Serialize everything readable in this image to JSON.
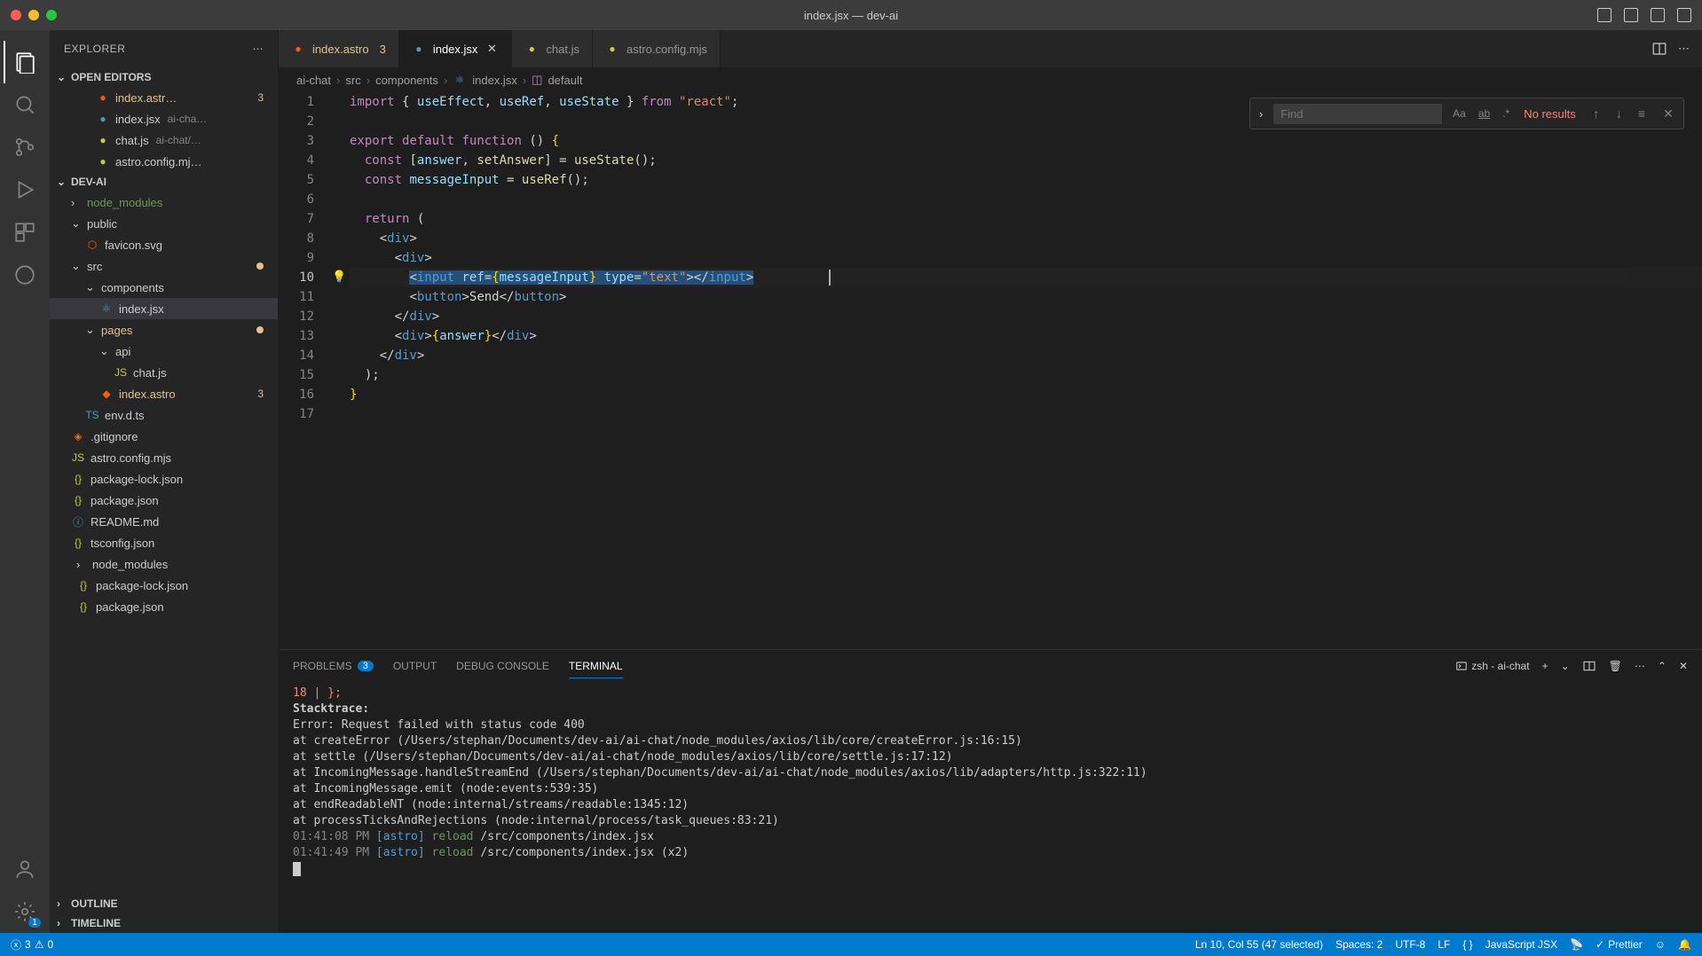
{
  "titlebar": {
    "title": "index.jsx — dev-ai"
  },
  "explorer": {
    "title": "EXPLORER",
    "openEditors": {
      "label": "OPEN EDITORS",
      "items": [
        {
          "name": "index.astr…",
          "iconClass": "fi-astro",
          "badge": "3",
          "closable": false
        },
        {
          "name": "index.jsx",
          "desc": "ai-cha…",
          "iconClass": "fi-jsx",
          "closable": true
        },
        {
          "name": "chat.js",
          "desc": "ai-chat/…",
          "iconClass": "fi-js",
          "closable": false
        },
        {
          "name": "astro.config.mj…",
          "iconClass": "fi-js",
          "closable": false
        }
      ]
    },
    "project": {
      "label": "DEV-AI"
    },
    "tree": [
      {
        "indent": 1,
        "chev": "›",
        "icon": "",
        "label": "node_modules",
        "dim": true
      },
      {
        "indent": 1,
        "chev": "⌄",
        "icon": "",
        "label": "public"
      },
      {
        "indent": 2,
        "icon": "⬡",
        "iconClass": "fi-astro",
        "label": "favicon.svg"
      },
      {
        "indent": 1,
        "chev": "⌄",
        "icon": "",
        "label": "src",
        "modified": true
      },
      {
        "indent": 2,
        "chev": "⌄",
        "icon": "",
        "label": "components"
      },
      {
        "indent": 3,
        "icon": "⚛",
        "iconClass": "fi-jsx",
        "label": "index.jsx",
        "active": true
      },
      {
        "indent": 2,
        "chev": "⌄",
        "icon": "",
        "label": "pages",
        "warn": true,
        "modified": true
      },
      {
        "indent": 3,
        "chev": "⌄",
        "icon": "",
        "label": "api"
      },
      {
        "indent": 4,
        "icon": "JS",
        "iconClass": "fi-js",
        "label": "chat.js"
      },
      {
        "indent": 3,
        "icon": "◆",
        "iconClass": "fi-astro",
        "label": "index.astro",
        "warn": true,
        "badge": "3"
      },
      {
        "indent": 2,
        "icon": "TS",
        "iconClass": "fi-ts",
        "label": "env.d.ts"
      },
      {
        "indent": 1,
        "icon": "◈",
        "iconClass": "fi-git",
        "label": ".gitignore"
      },
      {
        "indent": 1,
        "icon": "JS",
        "iconClass": "fi-js",
        "label": "astro.config.mjs"
      },
      {
        "indent": 1,
        "icon": "{}",
        "iconClass": "fi-json",
        "label": "package-lock.json"
      },
      {
        "indent": 1,
        "icon": "{}",
        "iconClass": "fi-json",
        "label": "package.json"
      },
      {
        "indent": 1,
        "icon": "ⓘ",
        "iconClass": "fi-md",
        "label": "README.md"
      },
      {
        "indent": 1,
        "icon": "{}",
        "iconClass": "fi-json",
        "label": "tsconfig.json"
      },
      {
        "indent": 0,
        "chev": "›",
        "icon": "",
        "label": "node_modules"
      },
      {
        "indent": 0,
        "icon": "{}",
        "iconClass": "fi-json",
        "label": "package-lock.json"
      },
      {
        "indent": 0,
        "icon": "{}",
        "iconClass": "fi-json",
        "label": "package.json"
      }
    ],
    "outline": {
      "label": "OUTLINE"
    },
    "timeline": {
      "label": "TIMELINE"
    }
  },
  "tabs": [
    {
      "label": "index.astro",
      "iconClass": "fi-astro",
      "badge": "3",
      "warn": true
    },
    {
      "label": "index.jsx",
      "iconClass": "fi-jsx",
      "active": true,
      "close": true
    },
    {
      "label": "chat.js",
      "iconClass": "fi-js"
    },
    {
      "label": "astro.config.mjs",
      "iconClass": "fi-js"
    }
  ],
  "breadcrumb": [
    "ai-chat",
    "src",
    "components",
    "index.jsx",
    "default"
  ],
  "find": {
    "placeholder": "Find",
    "results": "No results"
  },
  "code": {
    "lines": [
      {
        "n": 1,
        "html": "<span class='tok-kw'>import</span> <span class='tok-punc'>{</span> <span class='tok-var'>useEffect</span><span class='tok-punc'>,</span> <span class='tok-var'>useRef</span><span class='tok-punc'>,</span> <span class='tok-var'>useState</span> <span class='tok-punc'>}</span> <span class='tok-kw'>from</span> <span class='tok-str'>\"react\"</span><span class='tok-punc'>;</span>"
      },
      {
        "n": 2,
        "html": ""
      },
      {
        "n": 3,
        "html": "<span class='tok-kw'>export</span> <span class='tok-kw'>default</span> <span class='tok-kw'>function</span> <span class='tok-punc'>()</span> <span class='tok-brace'>{</span>"
      },
      {
        "n": 4,
        "html": "  <span class='tok-kw'>const</span> <span class='tok-punc'>[</span><span class='tok-var'>answer</span><span class='tok-punc'>,</span> <span class='tok-fn'>setAnswer</span><span class='tok-punc'>]</span> <span class='tok-punc'>=</span> <span class='tok-fn'>useState</span><span class='tok-punc'>();</span>"
      },
      {
        "n": 5,
        "html": "  <span class='tok-kw'>const</span> <span class='tok-var'>messageInput</span> <span class='tok-punc'>=</span> <span class='tok-fn'>useRef</span><span class='tok-punc'>();</span>"
      },
      {
        "n": 6,
        "html": ""
      },
      {
        "n": 7,
        "html": "  <span class='tok-kw'>return</span> <span class='tok-punc'>(</span>"
      },
      {
        "n": 8,
        "html": "    <span class='tok-punc'>&lt;</span><span class='tok-tag'>div</span><span class='tok-punc'>&gt;</span>"
      },
      {
        "n": 9,
        "html": "      <span class='tok-punc'>&lt;</span><span class='tok-tag'>div</span><span class='tok-punc'>&gt;</span>"
      },
      {
        "n": 10,
        "html": "        <span class='sel'><span class='tok-punc'>&lt;</span><span class='tok-tag'>input</span> <span class='tok-var'>ref</span><span class='tok-punc'>=</span><span class='tok-brace'>{</span><span class='tok-var'>messageInput</span><span class='tok-brace'>}</span> <span class='tok-var'>type</span><span class='tok-punc'>=</span><span class='tok-str'>\"text\"</span><span class='tok-punc'>&gt;&lt;/</span><span class='tok-tag'>input</span><span class='tok-punc'>&gt;</span></span>",
        "active": true
      },
      {
        "n": 11,
        "html": "        <span class='tok-punc'>&lt;</span><span class='tok-tag'>button</span><span class='tok-punc'>&gt;</span><span class='tok-text'>Send</span><span class='tok-punc'>&lt;/</span><span class='tok-tag'>button</span><span class='tok-punc'>&gt;</span>"
      },
      {
        "n": 12,
        "html": "      <span class='tok-punc'>&lt;/</span><span class='tok-tag'>div</span><span class='tok-punc'>&gt;</span>"
      },
      {
        "n": 13,
        "html": "      <span class='tok-punc'>&lt;</span><span class='tok-tag'>div</span><span class='tok-punc'>&gt;</span><span class='tok-brace'>{</span><span class='tok-var'>answer</span><span class='tok-brace'>}</span><span class='tok-punc'>&lt;/</span><span class='tok-tag'>div</span><span class='tok-punc'>&gt;</span>"
      },
      {
        "n": 14,
        "html": "    <span class='tok-punc'>&lt;/</span><span class='tok-tag'>div</span><span class='tok-punc'>&gt;</span>"
      },
      {
        "n": 15,
        "html": "  <span class='tok-punc'>);</span>"
      },
      {
        "n": 16,
        "html": "<span class='tok-brace'>}</span>"
      },
      {
        "n": 17,
        "html": ""
      }
    ]
  },
  "panel": {
    "tabs": {
      "problems": "PROBLEMS",
      "problemsBadge": "3",
      "output": "OUTPUT",
      "debug": "DEBUG CONSOLE",
      "terminal": "TERMINAL"
    },
    "terminalName": "zsh - ai-chat",
    "lines": [
      "<span class='term-red'>  18 | };</span>",
      "<span class='term-bold'>  Stacktrace:</span>",
      "Error: Request failed with status code 400",
      "    at createError (/Users/stephan/Documents/dev-ai/ai-chat/node_modules/axios/lib/core/createError.js:16:15)",
      "    at settle (/Users/stephan/Documents/dev-ai/ai-chat/node_modules/axios/lib/core/settle.js:17:12)",
      "    at IncomingMessage.handleStreamEnd (/Users/stephan/Documents/dev-ai/ai-chat/node_modules/axios/lib/adapters/http.js:322:11)",
      "    at IncomingMessage.emit (node:events:539:35)",
      "    at endReadableNT (node:internal/streams/readable:1345:12)",
      "    at processTicksAndRejections (node:internal/process/task_queues:83:21)",
      "",
      "<span class='term-dim'>01:41:08 PM</span> <span class='term-blue'>[astro]</span> <span class='term-green'>reload</span> /src/components/index.jsx",
      "<span class='term-dim'>01:41:49 PM</span> <span class='term-blue'>[astro]</span> <span class='term-green'>reload</span> /src/components/index.jsx (x2)"
    ]
  },
  "status": {
    "errors": "3",
    "warnings": "0",
    "cursor": "Ln 10, Col 55 (47 selected)",
    "spaces": "Spaces: 2",
    "encoding": "UTF-8",
    "eol": "LF",
    "lang": "JavaScript JSX",
    "prettier": "Prettier",
    "bracket": "{ }"
  },
  "activityBadge": "1"
}
